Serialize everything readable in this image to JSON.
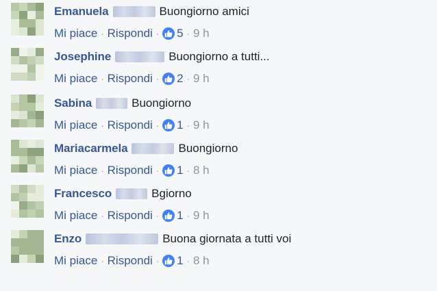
{
  "comments": [
    {
      "author": "Emanuela",
      "text": "Buongiorno amici",
      "like_label": "Mi piace",
      "reply_label": "Rispondi",
      "sep": "·",
      "reactions": "5",
      "time": "9 h"
    },
    {
      "author": "Josephine",
      "text": "Buongiorno a tutti...",
      "like_label": "Mi piace",
      "reply_label": "Rispondi",
      "sep": "·",
      "reactions": "2",
      "time": "9 h"
    },
    {
      "author": "Sabina",
      "text": "Buongiorno",
      "like_label": "Mi piace",
      "reply_label": "Rispondi",
      "sep": "·",
      "reactions": "1",
      "time": "9 h"
    },
    {
      "author": "Mariacarmela",
      "text": "Buongiorno",
      "like_label": "Mi piace",
      "reply_label": "Rispondi",
      "sep": "·",
      "reactions": "1",
      "time": "8 h"
    },
    {
      "author": "Francesco",
      "text": "Bgiorno",
      "like_label": "Mi piace",
      "reply_label": "Rispondi",
      "sep": "·",
      "reactions": "1",
      "time": "9 h"
    },
    {
      "author": "Enzo",
      "text": "Buona giornata a tutti voi",
      "like_label": "Mi piace",
      "reply_label": "Rispondi",
      "sep": "·",
      "reactions": "1",
      "time": "8 h"
    }
  ],
  "icons": {
    "reaction": "thumbs-up-icon"
  },
  "colors": {
    "author": "#365899",
    "link": "#365899",
    "meta": "#90949c",
    "reaction_badge": "#4080ff",
    "background": "#f6f7f9"
  }
}
